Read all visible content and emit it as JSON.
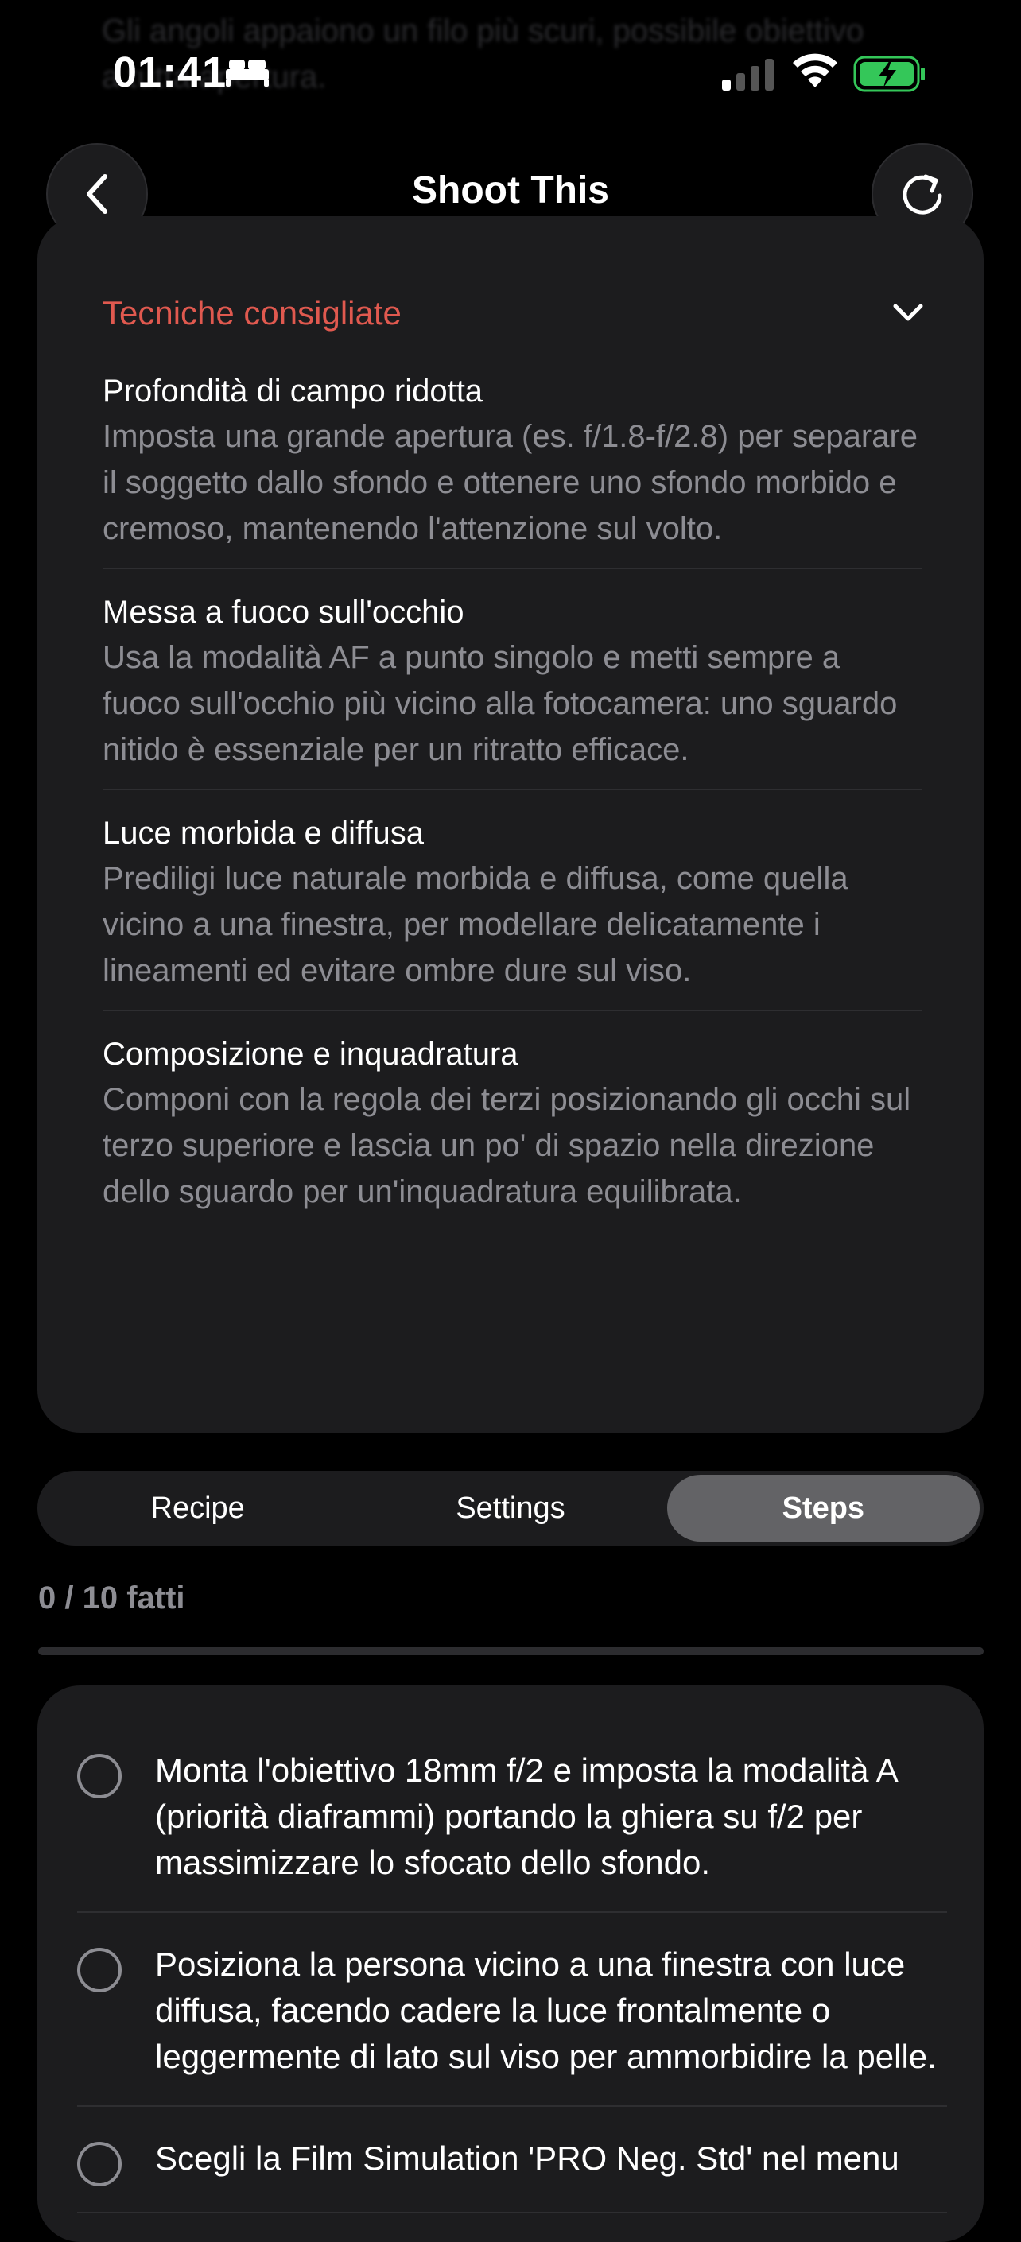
{
  "background_text": "Gli angoli appaiono un filo più scuri, possibile obiettivo a tutta apertura.",
  "status_bar": {
    "time": "01:41"
  },
  "nav": {
    "title": "Shoot This"
  },
  "techniques": {
    "header": "Tecniche consigliate",
    "items": [
      {
        "title": "Profondità di campo ridotta",
        "desc": "Imposta una grande apertura (es. f/1.8-f/2.8) per separare il soggetto dallo sfondo e ottenere uno sfondo morbido e cremoso, mantenendo l'attenzione sul volto."
      },
      {
        "title": "Messa a fuoco sull'occhio",
        "desc": "Usa la modalità AF a punto singolo e metti sempre a fuoco sull'occhio più vicino alla fotocamera: uno sguardo nitido è essenziale per un ritratto efficace."
      },
      {
        "title": "Luce morbida e diffusa",
        "desc": "Prediligi luce naturale morbida e diffusa, come quella vicino a una finestra, per modellare delicatamente i lineamenti ed evitare ombre dure sul viso."
      },
      {
        "title": "Composizione e inquadratura",
        "desc": "Componi con la regola dei terzi posizionando gli occhi sul terzo superiore e lascia un po' di spazio nella direzione dello sguardo per un'inquadratura equilibrata."
      }
    ]
  },
  "tabs": [
    {
      "label": "Recipe",
      "active": false
    },
    {
      "label": "Settings",
      "active": false
    },
    {
      "label": "Steps",
      "active": true
    }
  ],
  "progress": {
    "label": "0 / 10 fatti",
    "fraction": 0
  },
  "steps": [
    {
      "text": "Monta l'obiettivo 18mm f/2 e imposta la modalità A (priorità diaframmi) portando la ghiera su f/2 per massimizzare lo sfocato dello sfondo.",
      "done": false
    },
    {
      "text": "Posiziona la persona vicino a una finestra con luce diffusa, facendo cadere la luce frontalmente o leggermente di lato sul viso per ammorbidire la pelle.",
      "done": false
    },
    {
      "text": "Scegli la Film Simulation 'PRO Neg. Std' nel menu",
      "done": false
    }
  ],
  "colors": {
    "accent": "#e0594f",
    "card": "#1c1c1e",
    "battery": "#34c759"
  }
}
